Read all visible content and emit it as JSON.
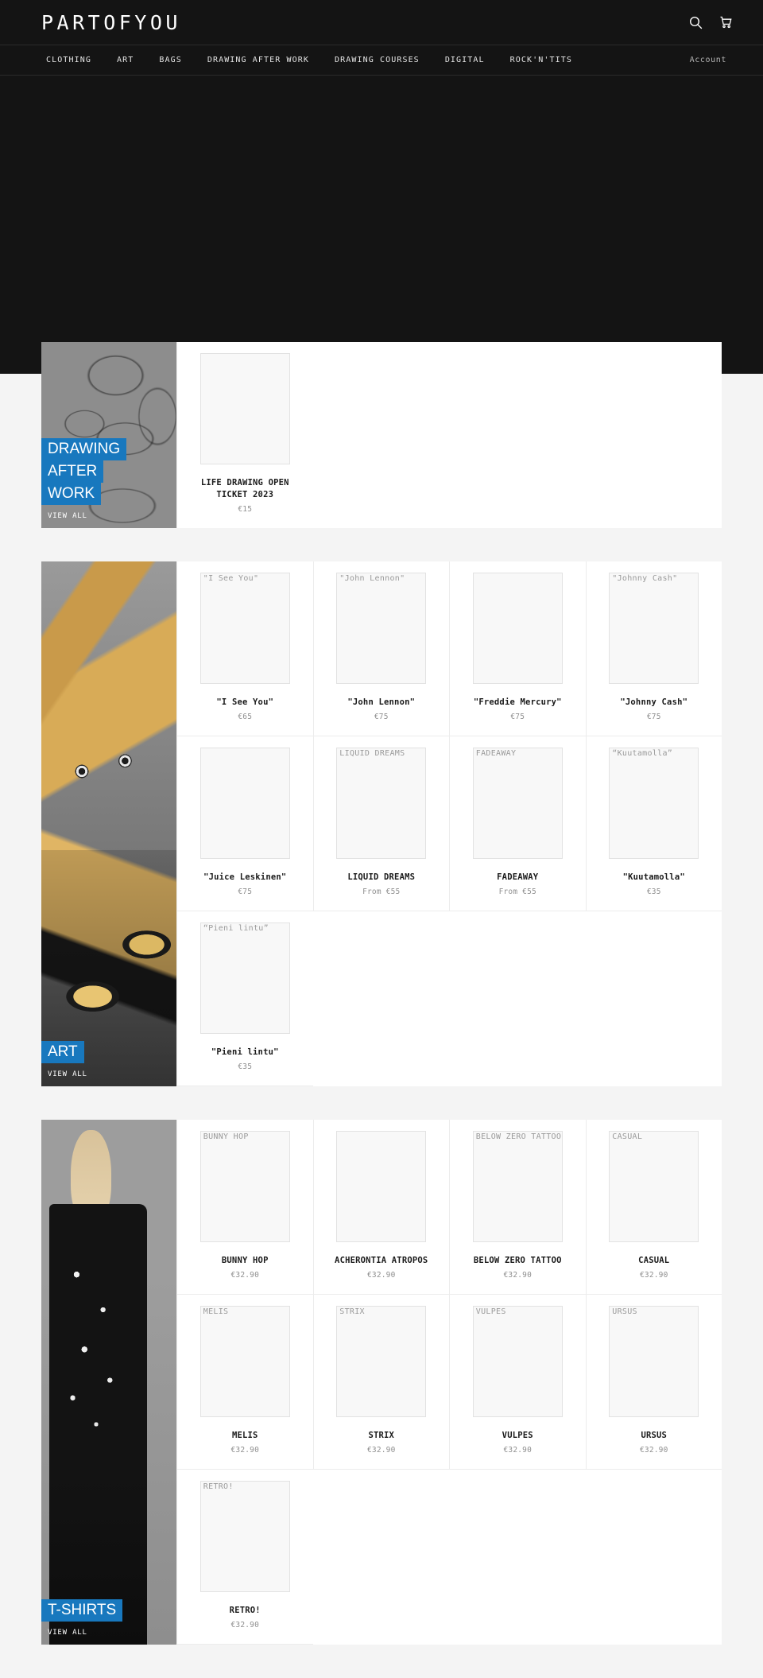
{
  "header": {
    "brand": "PARTOFYOU",
    "search_icon": "search-icon",
    "cart_icon": "cart-icon",
    "account_label": "Account",
    "nav": [
      {
        "label": "CLOTHING"
      },
      {
        "label": "ART"
      },
      {
        "label": "BAGS"
      },
      {
        "label": "DRAWING AFTER WORK"
      },
      {
        "label": "DRAWING COURSES"
      },
      {
        "label": "DIGITAL"
      },
      {
        "label": "ROCK'N'TITS"
      }
    ]
  },
  "colors": {
    "accent": "#1878be",
    "header_bg": "#141414",
    "page_bg": "#f4f4f4",
    "card_bg": "#ffffff"
  },
  "sections": [
    {
      "tile": {
        "title_lines": [
          "DRAWING",
          "AFTER",
          "WORK"
        ],
        "view_all": "VIEW ALL",
        "art": "sketch"
      },
      "columns": 1,
      "products": [
        {
          "alt": "",
          "title": "LIFE DRAWING OPEN TICKET 2023",
          "price": "€15"
        }
      ]
    },
    {
      "tile": {
        "title_lines": [
          "ART"
        ],
        "view_all": "VIEW ALL",
        "art": "painting"
      },
      "columns": 4,
      "products": [
        {
          "alt": "\"I See You\"",
          "title": "\"I See You\"",
          "price": "€65"
        },
        {
          "alt": "\"John Lennon\"",
          "title": "\"John Lennon\"",
          "price": "€75"
        },
        {
          "alt": "",
          "title": "\"Freddie Mercury\"",
          "price": "€75"
        },
        {
          "alt": "\"Johnny Cash\"",
          "title": "\"Johnny Cash\"",
          "price": "€75"
        },
        {
          "alt": "",
          "title": "\"Juice Leskinen\"",
          "price": "€75"
        },
        {
          "alt": "LIQUID DREAMS",
          "title": "LIQUID DREAMS",
          "price": "From €55"
        },
        {
          "alt": "FADEAWAY",
          "title": "FADEAWAY",
          "price": "From €55"
        },
        {
          "alt": "“Kuutamolla”",
          "title": "\"Kuutamolla\"",
          "price": "€35"
        },
        {
          "alt": "“Pieni lintu”",
          "title": "\"Pieni lintu\"",
          "price": "€35"
        }
      ]
    },
    {
      "tile": {
        "title_lines": [
          "T-SHIRTS"
        ],
        "view_all": "VIEW ALL",
        "art": "tee"
      },
      "columns": 4,
      "products": [
        {
          "alt": "BUNNY HOP",
          "title": "BUNNY HOP",
          "price": "€32.90"
        },
        {
          "alt": "",
          "title": "ACHERONTIA ATROPOS",
          "price": "€32.90"
        },
        {
          "alt": "BELOW ZERO TATTOO",
          "title": "BELOW ZERO TATTOO",
          "price": "€32.90"
        },
        {
          "alt": "CASUAL",
          "title": "CASUAL",
          "price": "€32.90"
        },
        {
          "alt": "MELIS",
          "title": "MELIS",
          "price": "€32.90"
        },
        {
          "alt": "STRIX",
          "title": "STRIX",
          "price": "€32.90"
        },
        {
          "alt": "VULPES",
          "title": "VULPES",
          "price": "€32.90"
        },
        {
          "alt": "URSUS",
          "title": "URSUS",
          "price": "€32.90"
        },
        {
          "alt": "RETRO!",
          "title": "RETRO!",
          "price": "€32.90"
        }
      ]
    }
  ]
}
